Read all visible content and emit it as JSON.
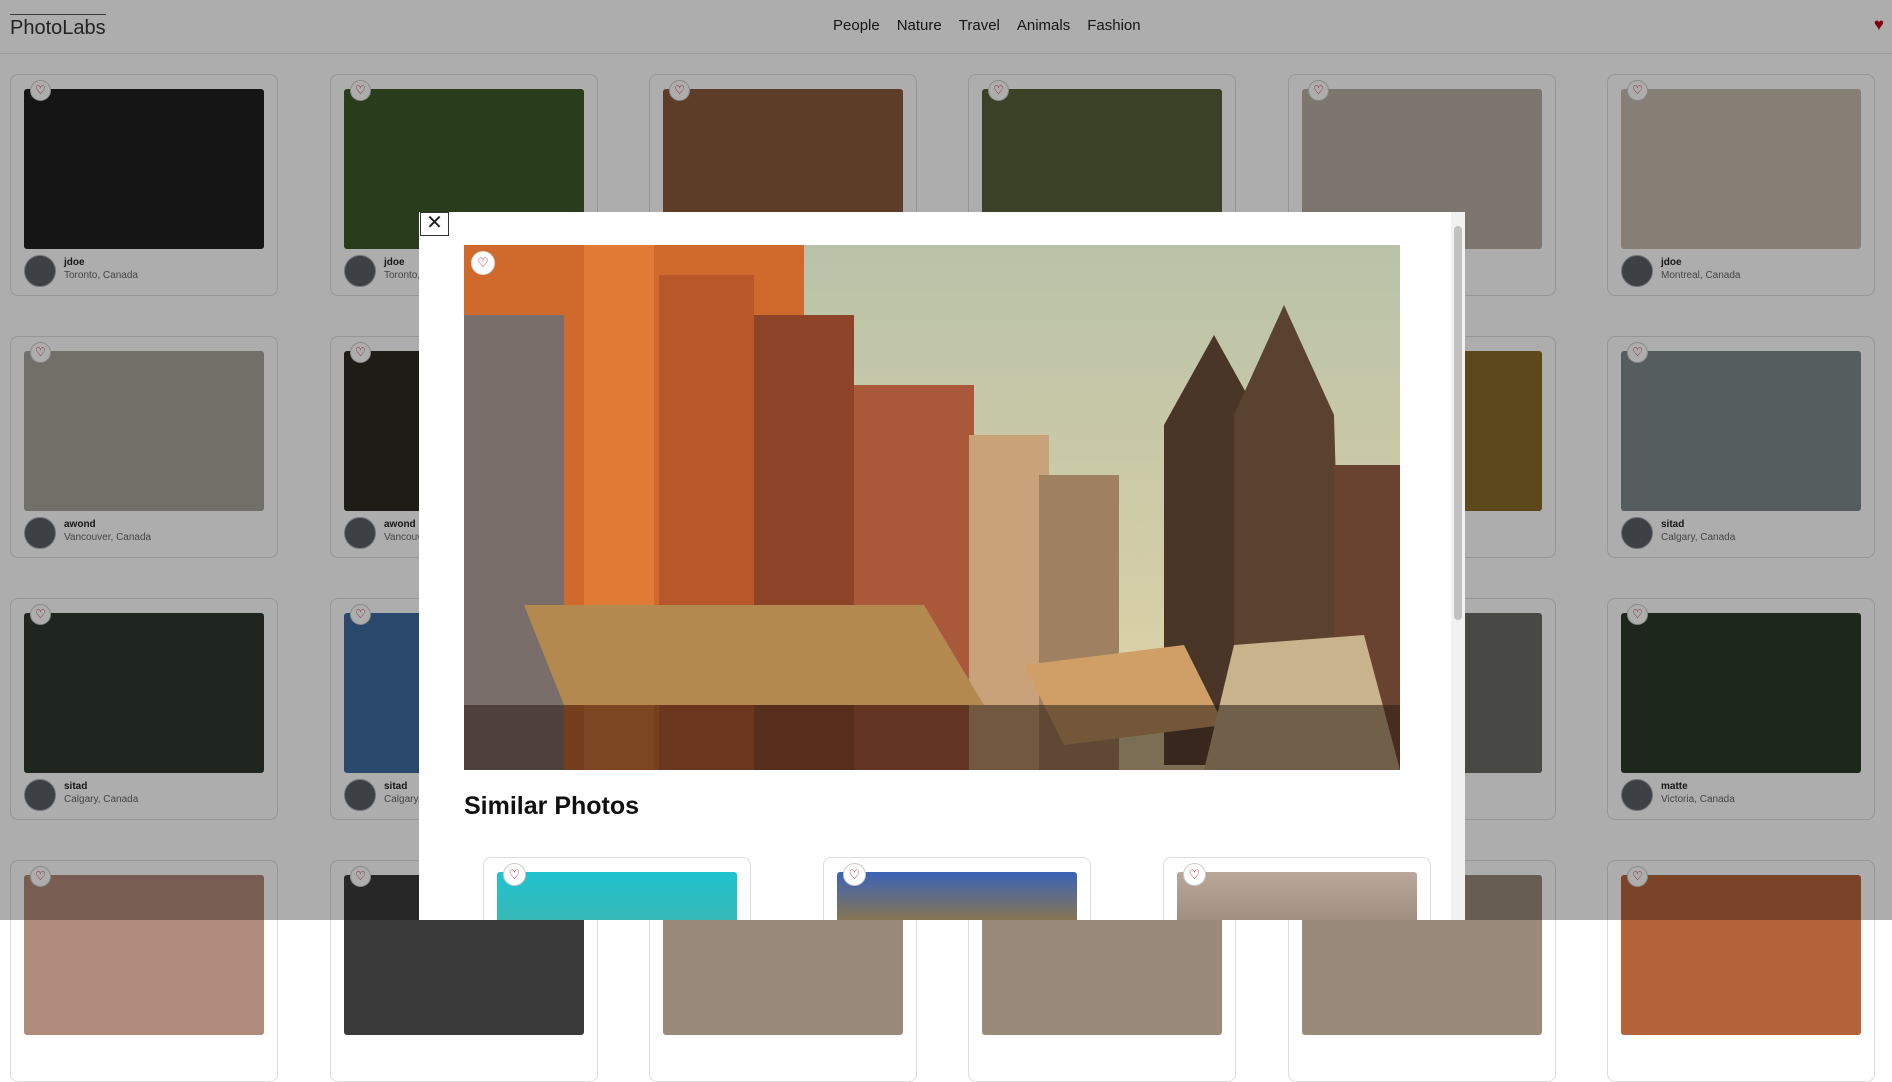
{
  "app": {
    "title": "PhotoLabs",
    "favorite_icon": "heart-icon"
  },
  "topics": [
    "People",
    "Nature",
    "Travel",
    "Animals",
    "Fashion"
  ],
  "grid_photos": [
    {
      "user": "jdoe",
      "location": "Toronto, Canada",
      "tone": "#1f1f1f"
    },
    {
      "user": "jdoe",
      "location": "Toronto, Canada",
      "tone": "#3d5a2c"
    },
    {
      "user": "",
      "location": "",
      "tone": "#8a5a3a"
    },
    {
      "user": "",
      "location": "",
      "tone": "#57603a"
    },
    {
      "user": "",
      "location": "",
      "tone": "#b7afa4"
    },
    {
      "user": "jdoe",
      "location": "Montreal, Canada",
      "tone": "#c4bcae"
    },
    {
      "user": "awond",
      "location": "Vancouver, Canada",
      "tone": "#a6a69a"
    },
    {
      "user": "awond",
      "location": "Vancouver, Canada",
      "tone": "#2c2a22"
    },
    {
      "user": "",
      "location": "",
      "tone": "#8a6a2a"
    },
    {
      "user": "",
      "location": "",
      "tone": "#8a6a2a"
    },
    {
      "user": "",
      "location": "",
      "tone": "#8a6a2a"
    },
    {
      "user": "sitad",
      "location": "Calgary, Canada",
      "tone": "#7f8a8c"
    },
    {
      "user": "sitad",
      "location": "Calgary, Canada",
      "tone": "#2f3830"
    },
    {
      "user": "sitad",
      "location": "Calgary, Canada",
      "tone": "#3f6aa0"
    },
    {
      "user": "",
      "location": "",
      "tone": "#6a6a66"
    },
    {
      "user": "",
      "location": "",
      "tone": "#6a6a66"
    },
    {
      "user": "",
      "location": "",
      "tone": "#6a6a66"
    },
    {
      "user": "matte",
      "location": "Victoria, Canada",
      "tone": "#2d3a28"
    },
    {
      "user": "",
      "location": "",
      "tone": "#b08a7a"
    },
    {
      "user": "",
      "location": "",
      "tone": "#3a3a3a"
    },
    {
      "user": "",
      "location": "",
      "tone": "#9a8a7a"
    },
    {
      "user": "",
      "location": "",
      "tone": "#9a8a7a"
    },
    {
      "user": "",
      "location": "",
      "tone": "#9a8a7a"
    },
    {
      "user": "",
      "location": "",
      "tone": "#b5633a"
    }
  ],
  "modal": {
    "close_icon": "close-icon",
    "heading": "Similar Photos",
    "main_photo": {
      "subject": "street buildings and temple spires",
      "favorite_icon": "heart-icon"
    },
    "similar": [
      {
        "tone_top": "#1fc2d0"
      },
      {
        "tone_top": "#3b63b7"
      },
      {
        "tone_top": "#b9a89a"
      }
    ]
  },
  "colors": {
    "accent": "#c00018",
    "overlay": "rgba(0,0,0,0.32)"
  }
}
